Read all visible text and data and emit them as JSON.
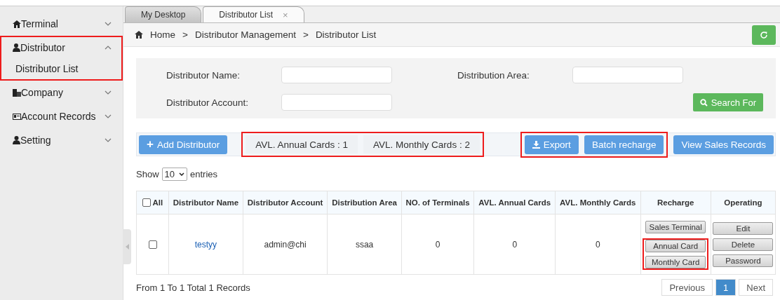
{
  "sidebar": {
    "items": [
      {
        "label": "Terminal",
        "expanded": false,
        "highlighted": false
      },
      {
        "label": "Distributor",
        "expanded": true,
        "highlighted": true,
        "children": [
          {
            "label": "Distributor List"
          }
        ]
      },
      {
        "label": "Company",
        "expanded": false,
        "highlighted": false
      },
      {
        "label": "Account Records",
        "expanded": false,
        "highlighted": false
      },
      {
        "label": "Setting",
        "expanded": false,
        "highlighted": false
      }
    ]
  },
  "tabs": [
    {
      "label": "My Desktop",
      "selected": false,
      "closable": false
    },
    {
      "label": "Distributor List",
      "selected": true,
      "closable": true,
      "close": "×"
    }
  ],
  "breadcrumb": {
    "items": [
      "Home",
      "Distributor Management",
      "Distributor List"
    ],
    "separator": ">"
  },
  "search": {
    "fields": [
      {
        "label": "Distributor Name:"
      },
      {
        "label": "Distribution Area:"
      },
      {
        "label": "Distributor Account:"
      }
    ],
    "button": "Search For"
  },
  "toolbar": {
    "add_button": "Add Distributor",
    "add_icon": "+",
    "counts": {
      "highlighted": true,
      "items": [
        "AVL. Annual Cards : 1",
        "AVL. Monthly Cards : 2"
      ]
    },
    "action_groups": [
      {
        "highlighted": true,
        "buttons": [
          {
            "label": "Export",
            "kind": "download"
          },
          {
            "label": "Batch recharge",
            "kind": "plain"
          }
        ]
      },
      {
        "highlighted": false,
        "buttons": [
          {
            "label": "View Sales Records",
            "kind": "plain"
          }
        ]
      }
    ]
  },
  "length_menu": {
    "before": "Show",
    "value": "10",
    "after": "entries"
  },
  "table": {
    "select_all": {
      "label": "All",
      "checked": false
    },
    "columns": [
      "Distributor Name",
      "Distributor Account",
      "Distribution Area",
      "NO. of Terminals",
      "AVL. Annual Cards",
      "AVL. Monthly Cards",
      "Recharge",
      "Operating"
    ],
    "rows": [
      {
        "checked": false,
        "cells": [
          "testyy",
          "admin@chi",
          "ssaa",
          "0",
          "0",
          "0"
        ],
        "recharge": [
          {
            "highlighted": false,
            "buttons": [
              "Sales Terminal"
            ]
          },
          {
            "highlighted": true,
            "buttons": [
              "Annual Card",
              "Monthly Card"
            ]
          }
        ],
        "operating": [
          "Edit",
          "Delete",
          "Password"
        ]
      }
    ]
  },
  "footer": {
    "info": "From 1 To 1 Total 1 Records",
    "pages": [
      {
        "label": "Previous",
        "selected": false
      },
      {
        "label": "1",
        "selected": true
      },
      {
        "label": "Next",
        "selected": false
      }
    ]
  }
}
